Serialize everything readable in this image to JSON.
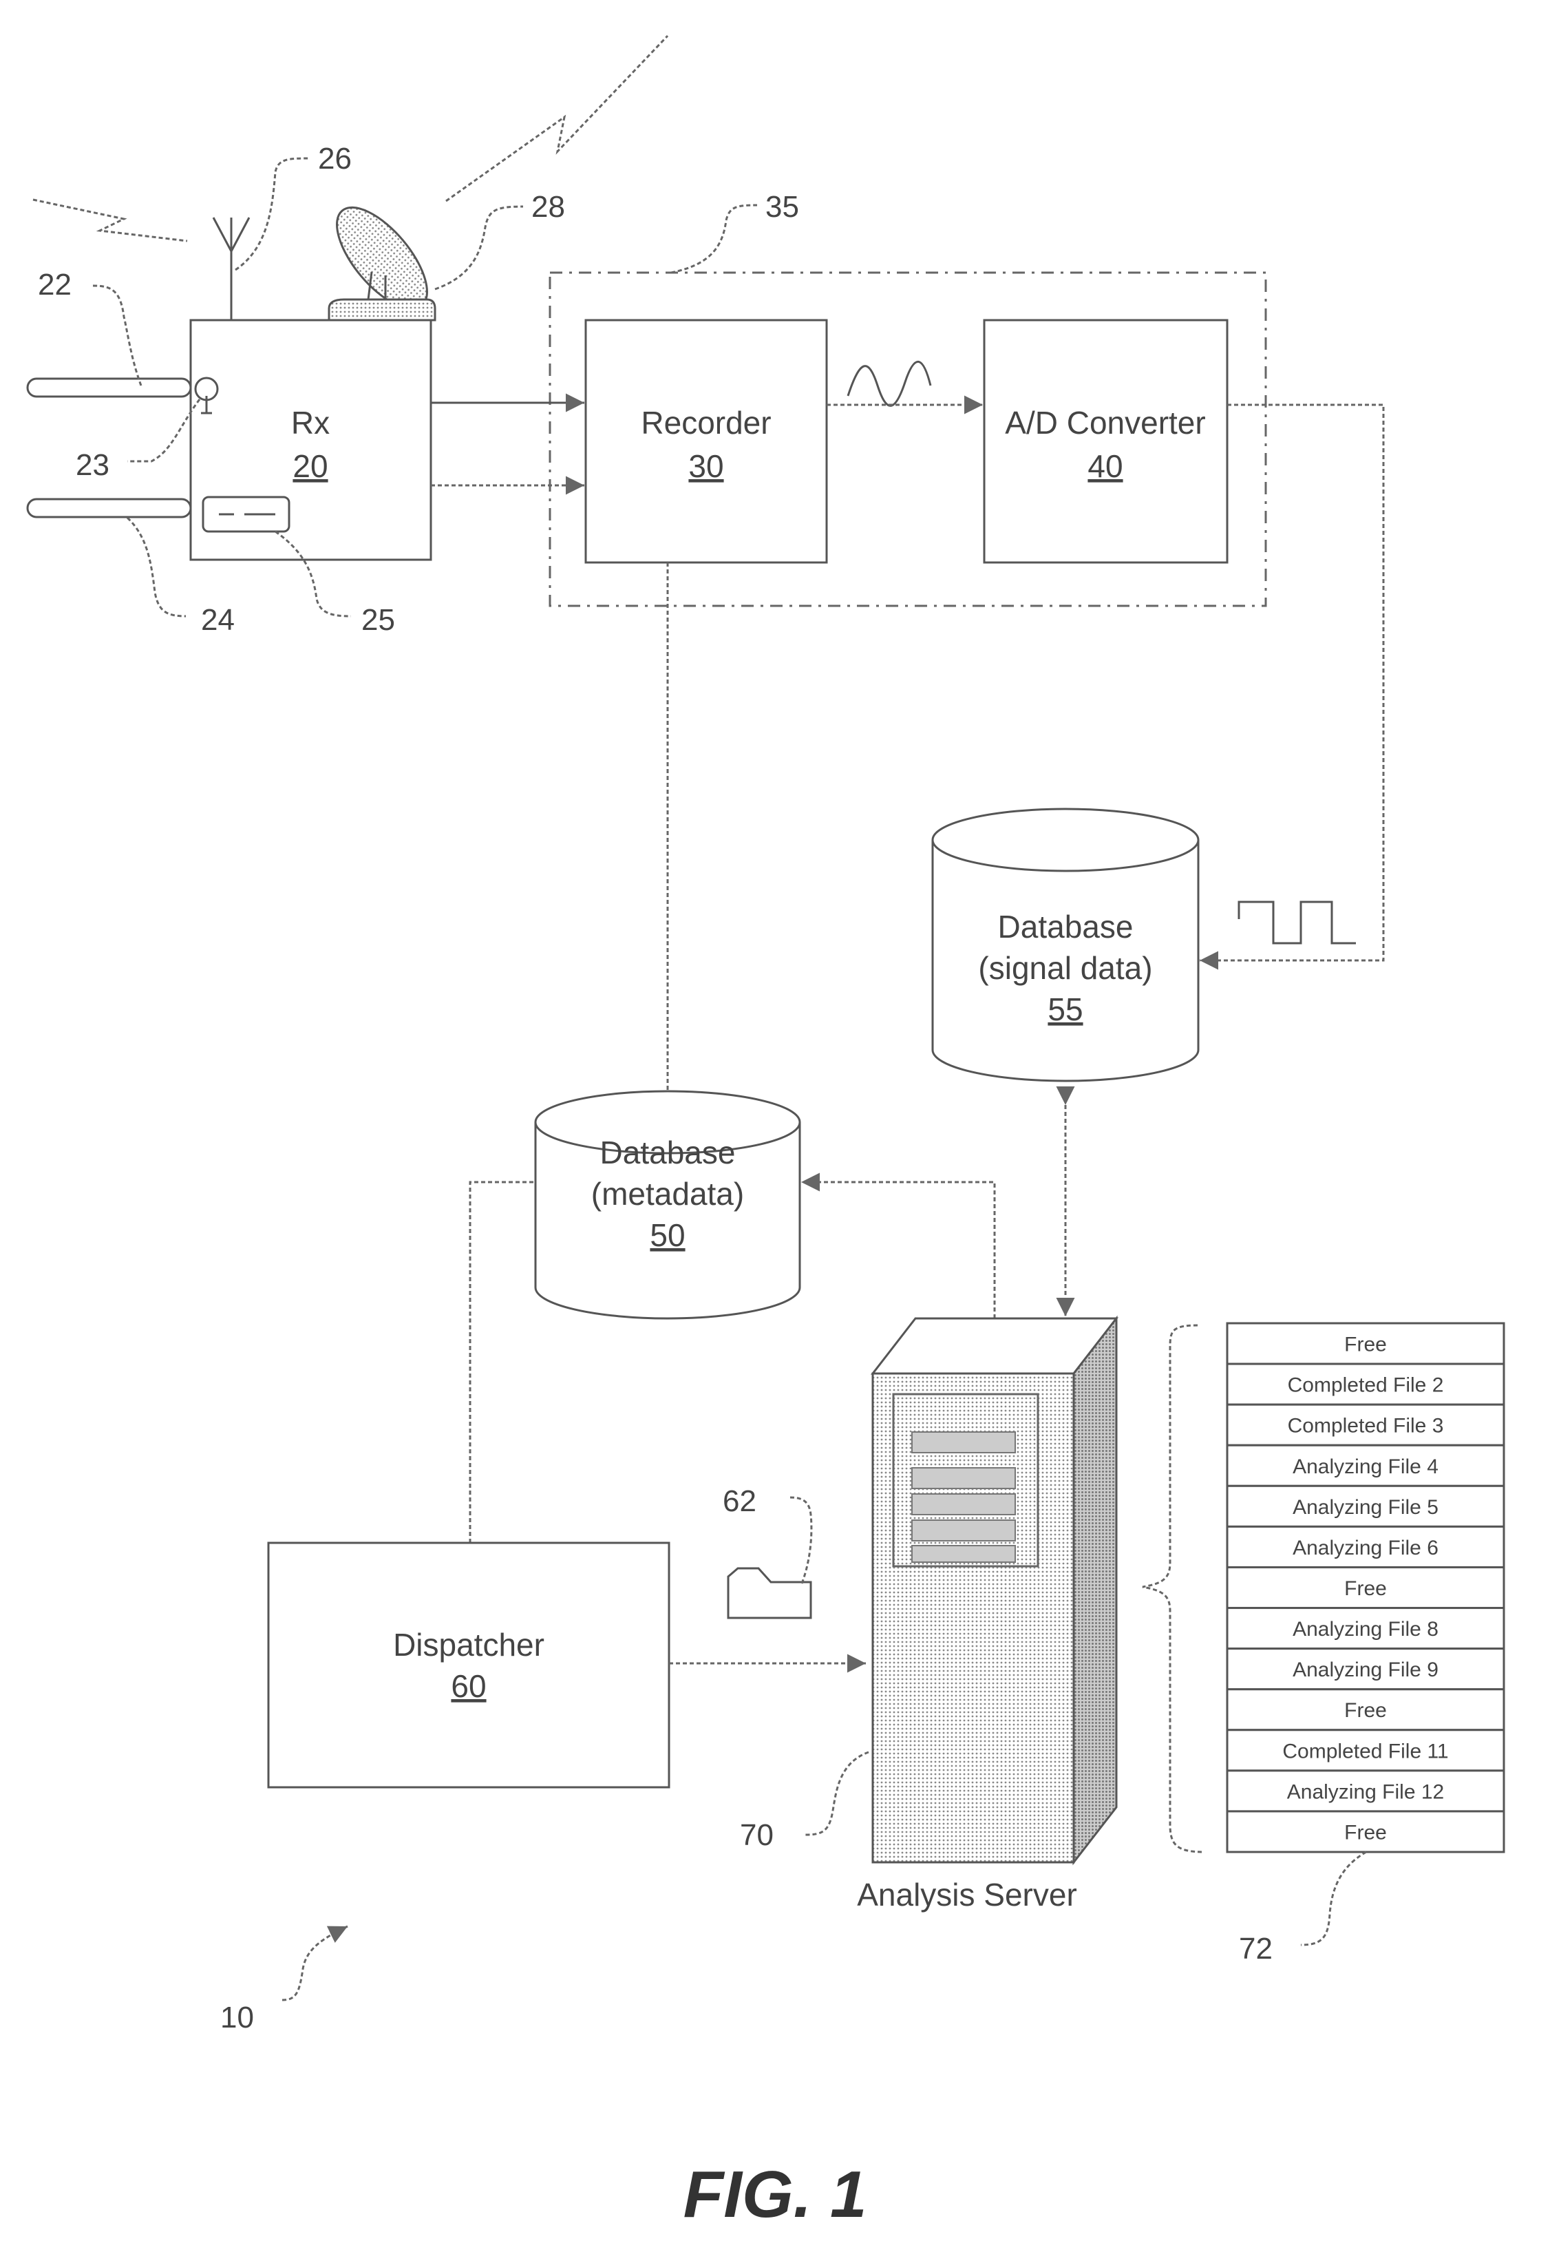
{
  "figure": {
    "caption": "FIG. 1",
    "system_ref": "10"
  },
  "receiver": {
    "label": "Rx",
    "ref": "20",
    "refs": {
      "input_22": "22",
      "connector_23": "23",
      "input_24": "24",
      "display_25": "25",
      "antenna_26": "26",
      "dish_28": "28"
    }
  },
  "recording_group": {
    "ref": "35"
  },
  "recorder": {
    "label": "Recorder",
    "ref": "30"
  },
  "ad_converter": {
    "label": "A/D Converter",
    "ref": "40"
  },
  "db_signal": {
    "line1": "Database",
    "line2": "(signal data)",
    "ref": "55"
  },
  "db_metadata": {
    "line1": "Database",
    "line2": "(metadata)",
    "ref": "50"
  },
  "dispatcher": {
    "label": "Dispatcher",
    "ref": "60",
    "file_ref": "62"
  },
  "server": {
    "label": "Analysis Server",
    "ref": "70"
  },
  "slots": {
    "ref": "72",
    "items": [
      "Free",
      "Completed File 2",
      "Completed File 3",
      "Analyzing File 4",
      "Analyzing File 5",
      "Analyzing File 6",
      "Free",
      "Analyzing File 8",
      "Analyzing File 9",
      "Free",
      "Completed File 11",
      "Analyzing File 12",
      "Free"
    ]
  }
}
